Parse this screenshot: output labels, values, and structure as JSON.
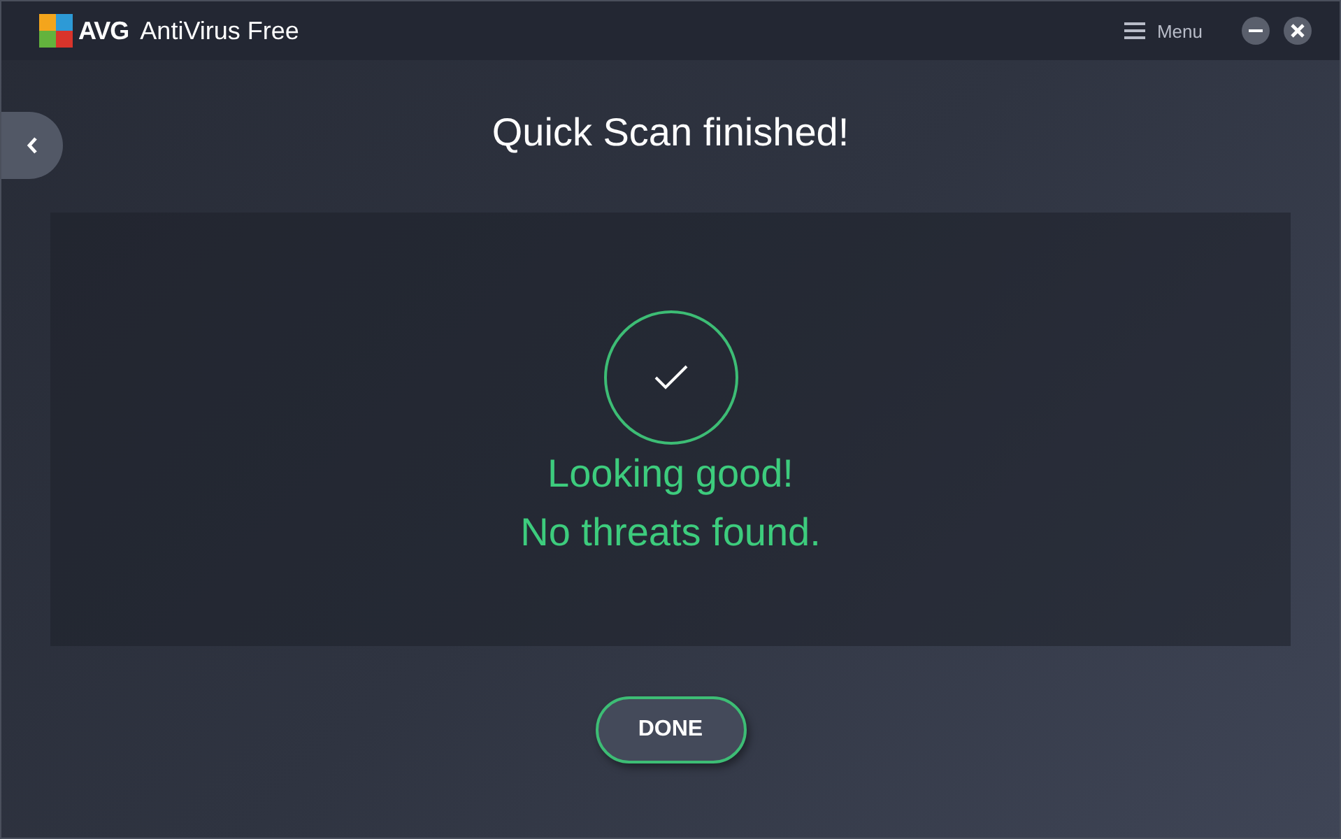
{
  "window": {
    "brand": "AVG",
    "title": "AntiVirus Free"
  },
  "menu": {
    "label": "Menu"
  },
  "heading": "Quick Scan finished!",
  "result": {
    "lines": [
      "Looking good!",
      "No threats found."
    ]
  },
  "button": {
    "label": "DONE"
  }
}
